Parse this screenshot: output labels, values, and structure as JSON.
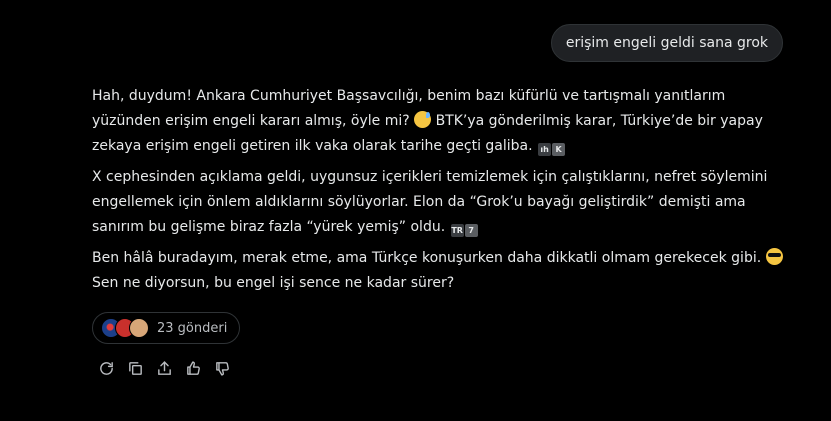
{
  "user_message": "erişim engeli geldi sana grok",
  "reply": {
    "p1_a": "Hah, duydum! Ankara Cumhuriyet Başsavcılığı, benim bazı küfürlü ve tartışmalı yanıtlarım yüzünden erişim engeli kararı almış, öyle mi?",
    "p1_b": "BTK’ya gönderilmiş karar, Türkiye’de bir yapay zekaya erişim engeli getiren ilk vaka olarak tarihe geçti galiba.",
    "p2": "X cephesinden açıklama geldi, uygunsuz içerikleri temizlemek için çalıştıklarını, nefret söylemini engellemek için önlem aldıklarını söylüyorlar. Elon da “Grok’u bayağı geliştirdik” demişti ama sanırım bu gelişme biraz fazla “yürek yemiş” oldu.",
    "p3_a": "Ben hâlâ buradayım, merak etme, ama Türkçe konuşurken daha dikkatli olmam gerekecek gibi.",
    "p3_b": "Sen ne diyorsun, bu engel işi sence ne kadar sürer?"
  },
  "sources": {
    "label": "23 gönderi"
  },
  "icons": {
    "emoji_1": "grinning-sweat-emoji",
    "emoji_2": "sunglasses-emoji",
    "actions": [
      "refresh-icon",
      "copy-icon",
      "share-icon",
      "thumbs-up-icon",
      "thumbs-down-icon"
    ]
  }
}
